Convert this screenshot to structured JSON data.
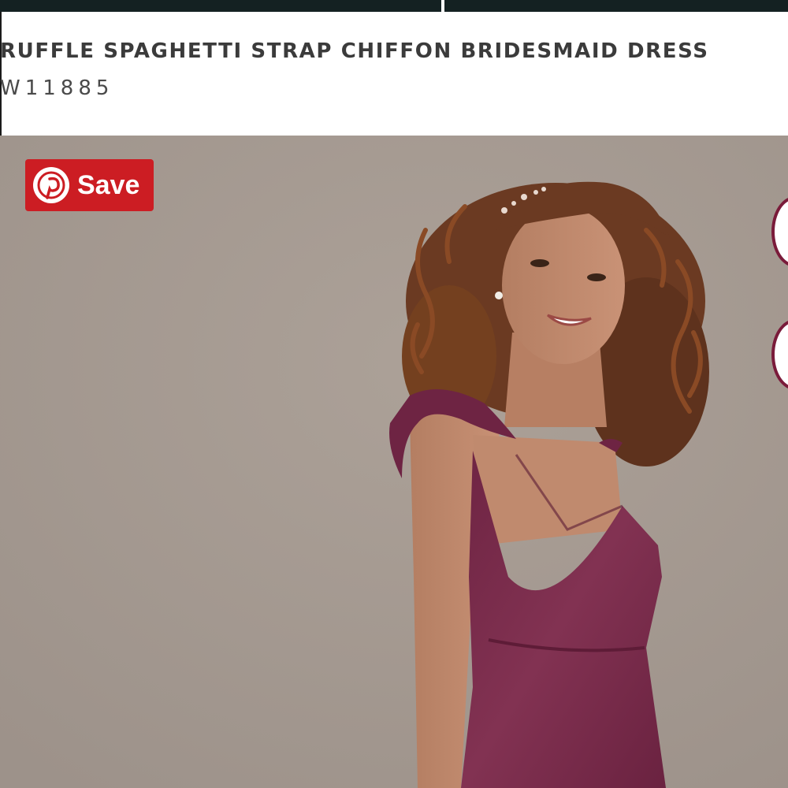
{
  "header": {
    "title": "RUFFLE SPAGHETTI STRAP CHIFFON BRIDESMAID DRESS",
    "style_number": "W11885"
  },
  "pinterest": {
    "save_label": "Save",
    "icon": "pinterest-icon",
    "brand_color": "#cc1d23"
  },
  "colors": {
    "top_bar": "#142122",
    "photo_background": "#a59a92",
    "dress": "#7b2c4c",
    "side_button_border": "#7a1b3a"
  }
}
